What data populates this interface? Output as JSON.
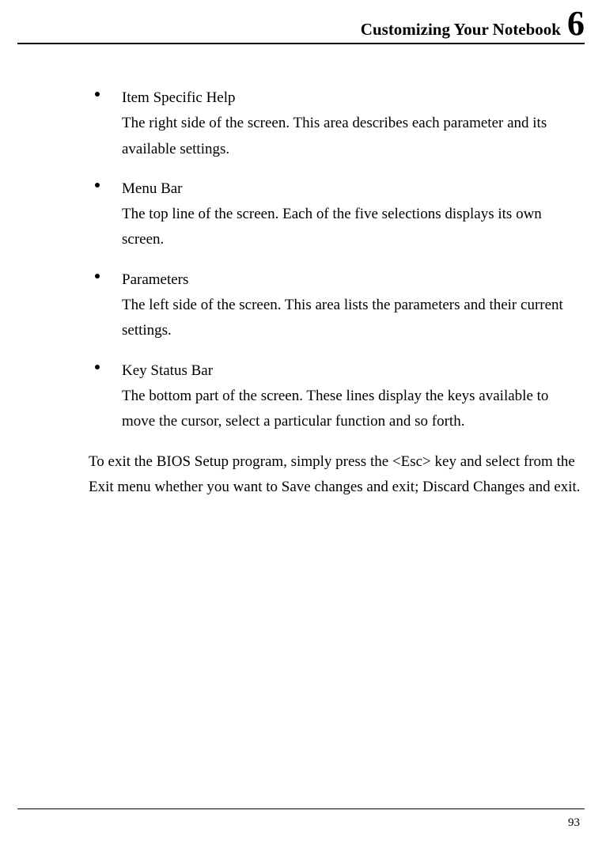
{
  "header": {
    "title": "Customizing Your Notebook",
    "chapter": "6"
  },
  "bullets": [
    {
      "title": "Item Specific Help",
      "desc": "The right side of the screen. This area describes each parameter and its available settings."
    },
    {
      "title": "Menu Bar",
      "desc": "The top line of the screen. Each of the five selections displays its own screen."
    },
    {
      "title": "Parameters",
      "desc": "The left side of the screen. This area lists the parameters and their current settings."
    },
    {
      "title": "Key Status Bar",
      "desc": "The bottom part of the screen. These lines display the keys available to move the cursor, select a particular function and so forth."
    }
  ],
  "exit_text": "To exit the BIOS Setup program, simply press the <Esc> key and select from the Exit menu whether you want to Save changes and exit; Discard Changes and exit.",
  "page_number": "93"
}
